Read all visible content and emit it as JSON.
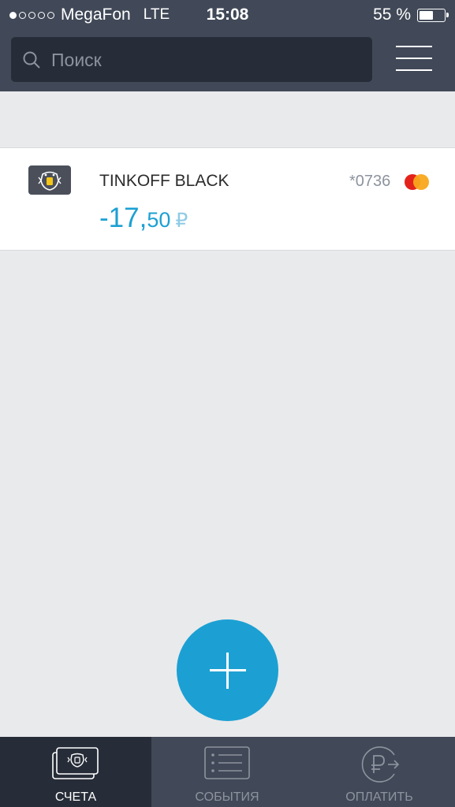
{
  "status_bar": {
    "signal_dots": 5,
    "signal_filled": 1,
    "carrier": "MegaFon",
    "network": "LTE",
    "time": "15:08",
    "battery_text": "55 %",
    "battery_level": 0.55
  },
  "header": {
    "search_placeholder": "Поиск",
    "menu_icon": "hamburger-menu-icon"
  },
  "accounts": [
    {
      "logo_icon": "tinkoff-logo-icon",
      "name": "TINKOFF BLACK",
      "card_number": "*0736",
      "payment_system_icon": "mastercard-icon",
      "balance_integer": "-17,",
      "balance_fraction": "50",
      "currency": "₽"
    }
  ],
  "fab": {
    "icon": "plus-icon"
  },
  "tab_bar": {
    "tabs": [
      {
        "label": "СЧЕТА",
        "icon": "accounts-card-icon",
        "active": true
      },
      {
        "label": "СОБЫТИЯ",
        "icon": "events-list-icon",
        "active": false
      },
      {
        "label": "ОПЛАТИТЬ",
        "icon": "pay-ruble-icon",
        "active": false
      }
    ]
  },
  "colors": {
    "bar_dark": "#414958",
    "search_bg": "#272d38",
    "accent_blue": "#1ca0d3",
    "background": "#e9eaec"
  }
}
